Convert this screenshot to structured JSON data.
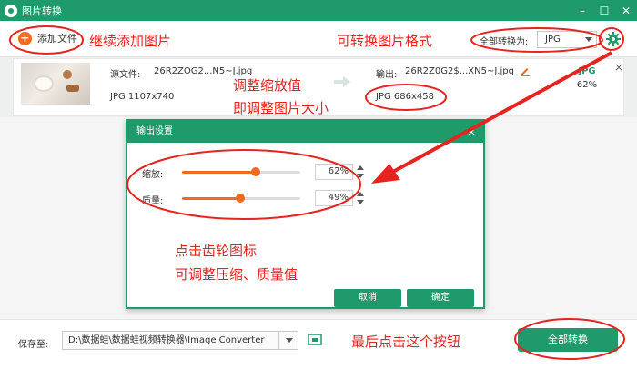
{
  "window": {
    "title": "图片转换",
    "minimize": "–",
    "maximize": "☐",
    "close": "✕"
  },
  "toolbar": {
    "add_label": "添加文件",
    "convert_all_label": "全部转换为:",
    "format_value": "JPG"
  },
  "file": {
    "source_label": "源文件:",
    "source_name": "26R2ZOG2...N5~J.jpg",
    "source_info": "JPG 1107x740",
    "output_label": "输出:",
    "output_name": "26R2Z0G2$...XN5~J.jpg",
    "output_info": "JPG 686x458",
    "badge_format": "JPG",
    "badge_percent": "62%",
    "close": "×"
  },
  "dialog": {
    "title": "输出设置",
    "close": "×",
    "scale_label": "缩放:",
    "scale_value": "62%",
    "scale_level": 62,
    "quality_label": "质量:",
    "quality_value": "49%",
    "quality_level": 49,
    "cancel": "取消",
    "ok": "确定"
  },
  "bottom": {
    "save_label": "保存至:",
    "path": "D:\\数据蛙\\数据蛙视频转换器\\Image Converter",
    "convert_button": "全部转换"
  },
  "annotations": {
    "add_images": "继续添加图片",
    "convert_format": "可转换图片格式",
    "adjust_scale_1": "调整缩放值",
    "adjust_scale_2": "即调整图片大小",
    "gear_1": "点击齿轮图标",
    "gear_2": "可调整压缩、质量值",
    "final": "最后点击这个按钮"
  },
  "colors": {
    "accent": "#1f9a6a",
    "slider": "#f26a21",
    "annotation": "#e52420"
  }
}
